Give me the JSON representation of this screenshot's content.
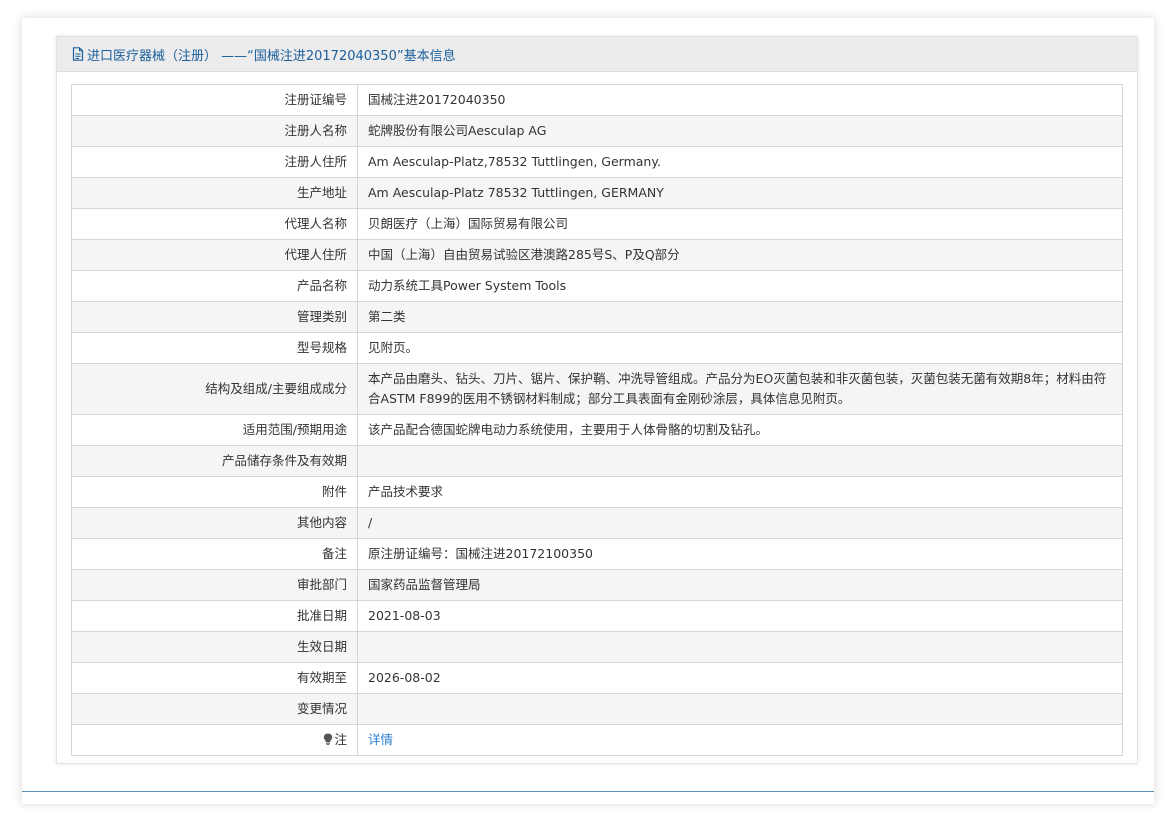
{
  "panel": {
    "icon": "document-icon",
    "title": "进口医疗器械（注册） ——“国械注进20172040350”基本信息"
  },
  "rows": [
    {
      "label": "注册证编号",
      "value": "国械注进20172040350"
    },
    {
      "label": "注册人名称",
      "value": "蛇牌股份有限公司Aesculap AG"
    },
    {
      "label": "注册人住所",
      "value": "Am Aesculap-Platz,78532 Tuttlingen, Germany."
    },
    {
      "label": "生产地址",
      "value": "Am Aesculap-Platz 78532 Tuttlingen, GERMANY"
    },
    {
      "label": "代理人名称",
      "value": "贝朗医疗（上海）国际贸易有限公司"
    },
    {
      "label": "代理人住所",
      "value": "中国（上海）自由贸易试验区港澳路285号S、P及Q部分"
    },
    {
      "label": "产品名称",
      "value": "动力系统工具Power System Tools"
    },
    {
      "label": "管理类别",
      "value": "第二类"
    },
    {
      "label": "型号规格",
      "value": "见附页。"
    },
    {
      "label": "结构及组成/主要组成成分",
      "value": "本产品由磨头、钻头、刀片、锯片、保护鞘、冲洗导管组成。产品分为EO灭菌包装和非灭菌包装，灭菌包装无菌有效期8年；材料由符合ASTM F899的医用不锈钢材料制成；部分工具表面有金刚砂涂层，具体信息见附页。"
    },
    {
      "label": "适用范围/预期用途",
      "value": "该产品配合德国蛇牌电动力系统使用，主要用于人体骨骼的切割及钻孔。"
    },
    {
      "label": "产品储存条件及有效期",
      "value": ""
    },
    {
      "label": "附件",
      "value": "产品技术要求"
    },
    {
      "label": "其他内容",
      "value": "/"
    },
    {
      "label": "备注",
      "value": "原注册证编号：国械注进20172100350"
    },
    {
      "label": "审批部门",
      "value": "国家药品监督管理局"
    },
    {
      "label": "批准日期",
      "value": "2021-08-03"
    },
    {
      "label": "生效日期",
      "value": ""
    },
    {
      "label": "有效期至",
      "value": "2026-08-02"
    },
    {
      "label": "变更情况",
      "value": ""
    }
  ],
  "note": {
    "icon": "lightbulb-icon",
    "label": "注",
    "link_text": "详情"
  },
  "colors": {
    "title": "#1a5f9c",
    "link": "#2b7fd0",
    "header_bg": "#ececec",
    "row_alt_bg": "#f5f5f5",
    "border": "#d6d6d6"
  }
}
